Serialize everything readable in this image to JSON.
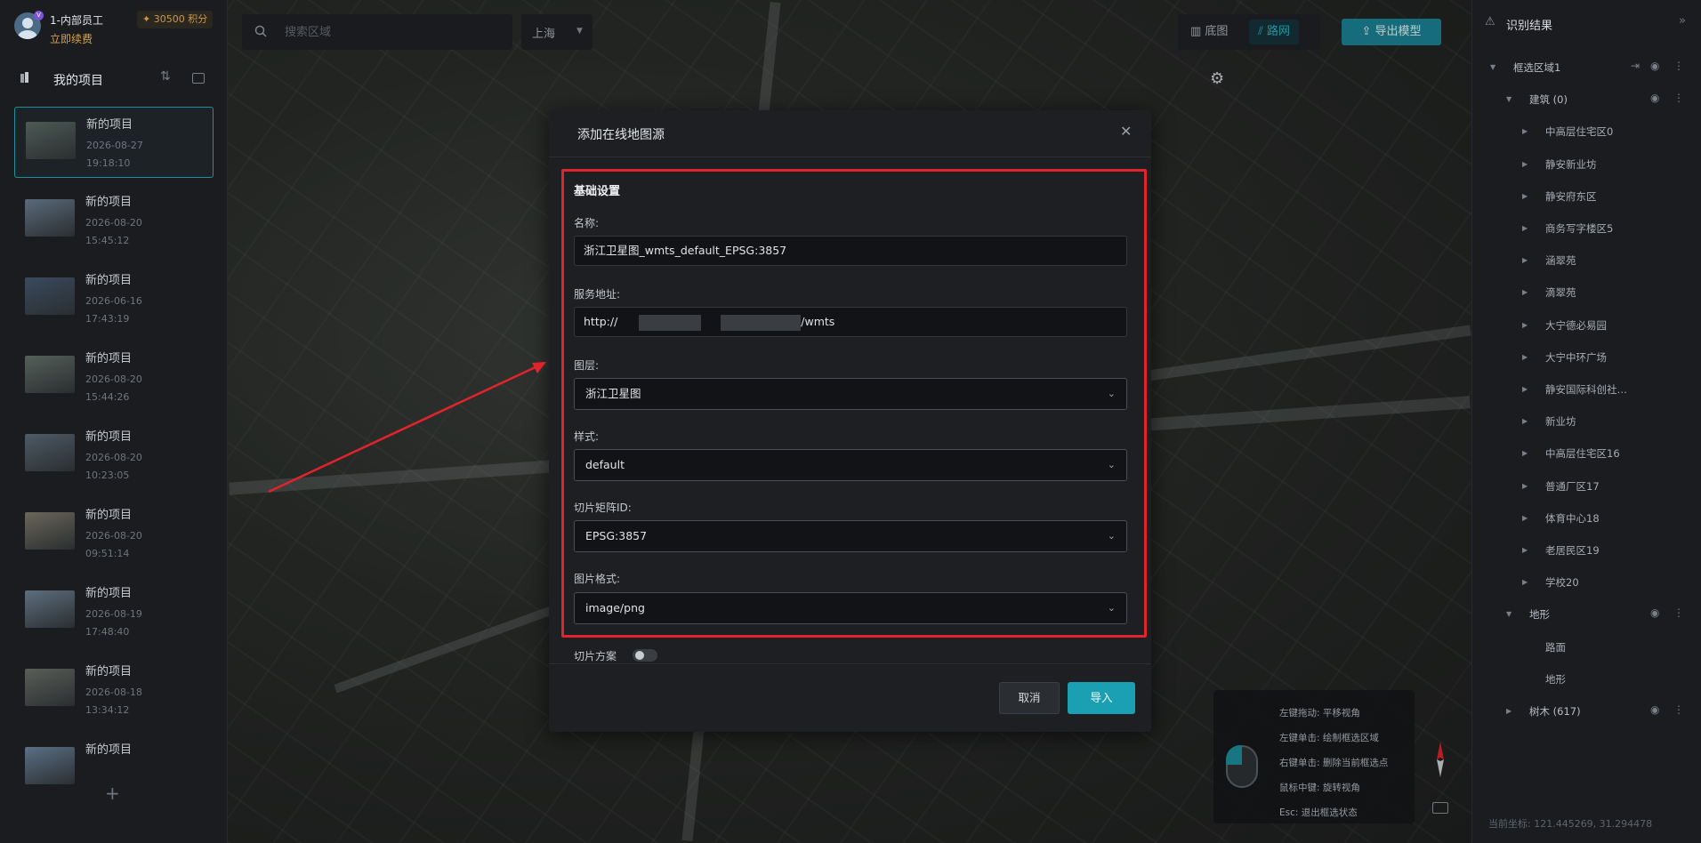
{
  "user": {
    "name": "1-内部员工",
    "renew": "立即续费",
    "points": "30500 积分",
    "badge": "V"
  },
  "projects_panel": {
    "title": "我的项目",
    "items": [
      {
        "name": "新的项目",
        "date": "2026-08-27",
        "time": "19:18:10",
        "active": true
      },
      {
        "name": "新的项目",
        "date": "2026-08-20",
        "time": "15:45:12"
      },
      {
        "name": "新的项目",
        "date": "2026-06-16",
        "time": "17:43:19"
      },
      {
        "name": "新的项目",
        "date": "2026-08-20",
        "time": "15:44:26"
      },
      {
        "name": "新的项目",
        "date": "2026-08-20",
        "time": "10:23:05"
      },
      {
        "name": "新的项目",
        "date": "2026-08-20",
        "time": "09:51:14"
      },
      {
        "name": "新的项目",
        "date": "2026-08-19",
        "time": "17:48:40"
      },
      {
        "name": "新的项目",
        "date": "2026-08-18",
        "time": "13:34:12"
      },
      {
        "name": "新的项目",
        "date": "",
        "time": ""
      }
    ],
    "add": "+"
  },
  "search": {
    "placeholder": "搜索区域"
  },
  "city": {
    "value": "上海"
  },
  "toolbar": {
    "basemap": "底图",
    "road": "路网",
    "export": "导出模型"
  },
  "results": {
    "title": "识别结果",
    "tree": [
      {
        "label": "框选区域1",
        "level": 0
      },
      {
        "label": "建筑 (0)",
        "level": 1
      },
      {
        "label": "中高层住宅区0",
        "level": 2
      },
      {
        "label": "静安新业坊",
        "level": 2
      },
      {
        "label": "静安府东区",
        "level": 2
      },
      {
        "label": "商务写字楼区5",
        "level": 2
      },
      {
        "label": "涵翠苑",
        "level": 2
      },
      {
        "label": "滴翠苑",
        "level": 2
      },
      {
        "label": "大宁德必易园",
        "level": 2
      },
      {
        "label": "大宁中环广场",
        "level": 2
      },
      {
        "label": "静安国际科创社…",
        "level": 2
      },
      {
        "label": "新业坊",
        "level": 2
      },
      {
        "label": "中高层住宅区16",
        "level": 2
      },
      {
        "label": "普通厂区17",
        "level": 2
      },
      {
        "label": "体育中心18",
        "level": 2
      },
      {
        "label": "老居民区19",
        "level": 2
      },
      {
        "label": "学校20",
        "level": 2
      },
      {
        "label": "地形",
        "level": 1
      },
      {
        "label": "路面",
        "level": 2
      },
      {
        "label": "地形",
        "level": 2
      },
      {
        "label": "树木 (617)",
        "level": 1
      }
    ],
    "coords": "当前坐标: 121.445269, 31.294478"
  },
  "help": {
    "lines": [
      "左键拖动: 平移视角",
      "左键单击: 绘制框选区域",
      "右键单击: 删除当前框选点",
      "鼠标中键: 旋转视角",
      "Esc: 退出框选状态"
    ]
  },
  "dialog": {
    "title": "添加在线地图源",
    "section": "基础设置",
    "name_label": "名称:",
    "name_value": "浙江卫星图_wmts_default_EPSG:3857",
    "url_label": "服务地址:",
    "url_prefix": "http://",
    "url_suffix": "/wmts",
    "layer_label": "图层:",
    "layer_value": "浙江卫星图",
    "style_label": "样式:",
    "style_value": "default",
    "matrix_label": "切片矩阵ID:",
    "matrix_value": "EPSG:3857",
    "format_label": "图片格式:",
    "format_value": "image/png",
    "tile_scheme_label": "切片方案",
    "tile_scheme_on": false,
    "cancel": "取消",
    "import": "导入"
  },
  "colors": {
    "accent": "#1aa0b2",
    "highlight": "#e0242b",
    "warn": "#d8a24a"
  }
}
